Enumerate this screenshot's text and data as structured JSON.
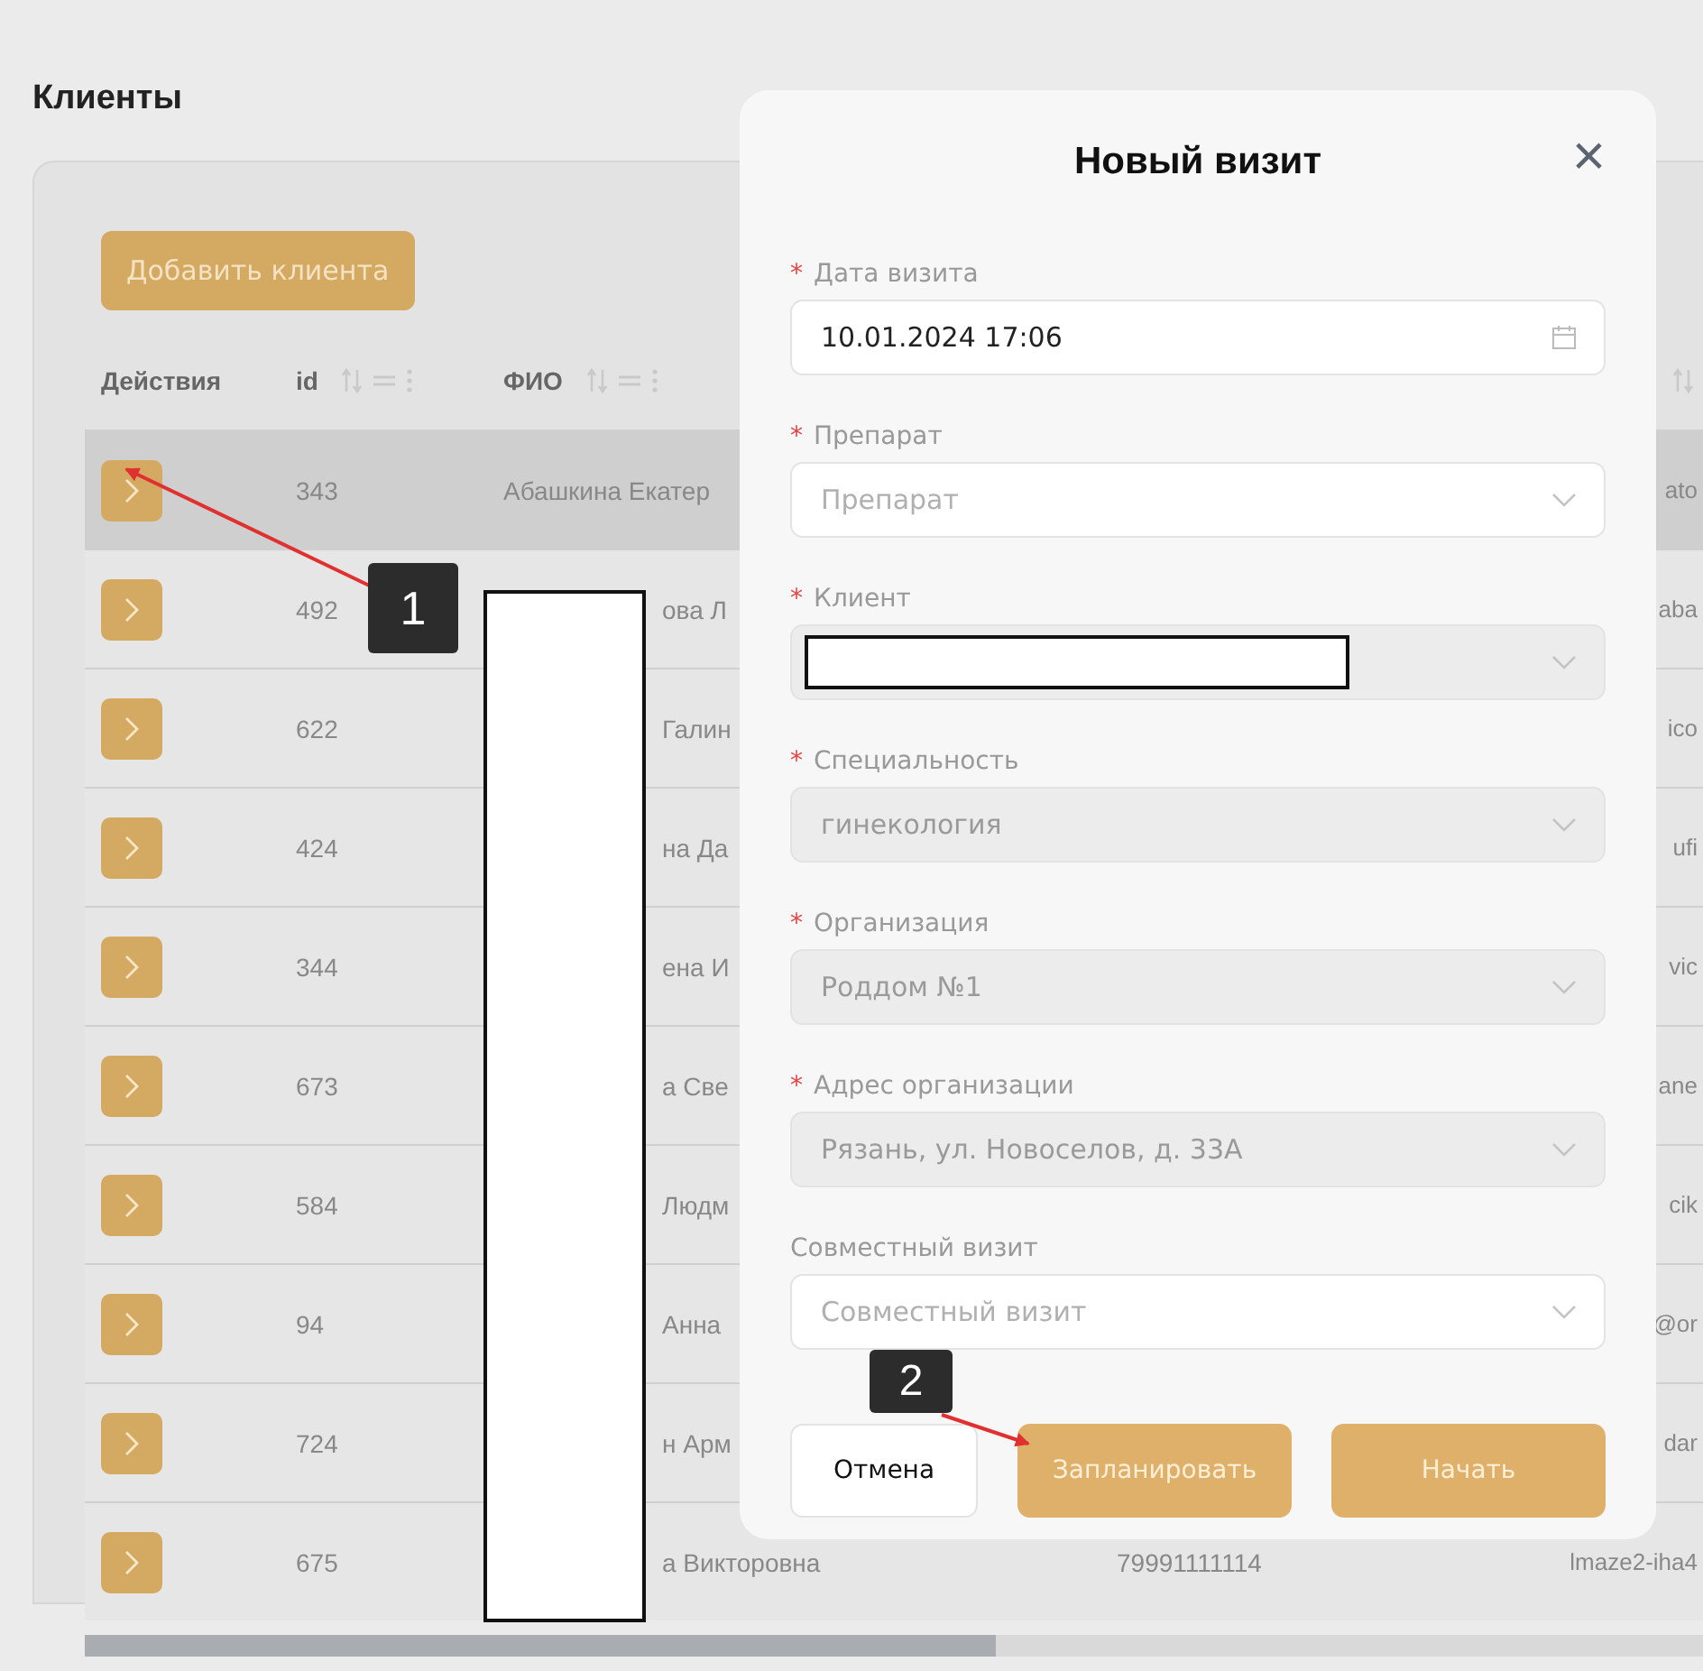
{
  "page": {
    "title": "Клиенты"
  },
  "toolbar": {
    "add_button": "Добавить клиента"
  },
  "table": {
    "columns": [
      "Действия",
      "id",
      "ФИО"
    ],
    "rows": [
      {
        "id": "343",
        "fio": "Абашкина Екатер",
        "masked": false,
        "selected": true,
        "email": "ato"
      },
      {
        "id": "492",
        "fio": "ова Л",
        "masked": true,
        "selected": false,
        "email": "aba"
      },
      {
        "id": "622",
        "fio": "Галин",
        "masked": true,
        "selected": false,
        "email": "ico"
      },
      {
        "id": "424",
        "fio": "на Да",
        "masked": true,
        "selected": false,
        "email": "ufi"
      },
      {
        "id": "344",
        "fio": "ена И",
        "masked": true,
        "selected": false,
        "email": "vic"
      },
      {
        "id": "673",
        "fio": "а Све",
        "masked": true,
        "selected": false,
        "email": "ane"
      },
      {
        "id": "584",
        "fio": "Людм",
        "masked": true,
        "selected": false,
        "email": "cik"
      },
      {
        "id": "94",
        "fio": "Анна",
        "masked": true,
        "selected": false,
        "email": "@or"
      },
      {
        "id": "724",
        "fio": "н Арм",
        "masked": true,
        "selected": false,
        "email": "dar"
      },
      {
        "id": "675",
        "fio": "а Викторовна",
        "masked": true,
        "selected": false,
        "phone": "79991111114",
        "email": "lmaze2-iha4"
      }
    ]
  },
  "modal": {
    "title": "Новый визит",
    "close": "×",
    "required_mark": "*",
    "fields": [
      {
        "kind": "date",
        "label": "Дата визита",
        "required": true,
        "disabled": false,
        "value": "10.01.2024 17:06"
      },
      {
        "kind": "select",
        "label": "Препарат",
        "required": true,
        "disabled": false,
        "placeholder": "Препарат"
      },
      {
        "kind": "select",
        "label": "Клиент",
        "required": true,
        "disabled": true,
        "redacted": true
      },
      {
        "kind": "select",
        "label": "Специальность",
        "required": true,
        "disabled": true,
        "value": "гинекология"
      },
      {
        "kind": "select",
        "label": "Организация",
        "required": true,
        "disabled": true,
        "value": "Роддом №1"
      },
      {
        "kind": "select",
        "label": "Адрес организации",
        "required": true,
        "disabled": true,
        "value": "Рязань, ул. Новоселов, д. 33А"
      },
      {
        "kind": "select",
        "label": "Совместный визит",
        "required": false,
        "disabled": false,
        "placeholder": "Совместный визит"
      }
    ],
    "buttons": [
      {
        "label": "Отмена",
        "kind": "secondary"
      },
      {
        "label": "Запланировать",
        "kind": "primary"
      },
      {
        "label": "Начать",
        "kind": "primary"
      }
    ]
  },
  "annotations": [
    {
      "label": "1"
    },
    {
      "label": "2"
    }
  ]
}
